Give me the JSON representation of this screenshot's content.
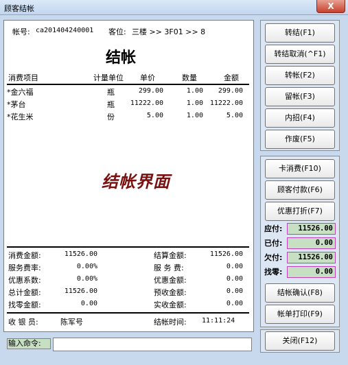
{
  "window": {
    "title": "顾客结帐",
    "close_glyph": "X"
  },
  "header": {
    "account_label": "帐号:",
    "account_no": "ca201404240001",
    "seat_label": "客位:",
    "seat_value": "三楼 >> 3F01 >> 8"
  },
  "receipt_title": "结帐",
  "columns": [
    "消费项目",
    "计量单位",
    "单价",
    "数量",
    "金额"
  ],
  "items": [
    {
      "name": "*金六福",
      "unit": "瓶",
      "price": "299.00",
      "qty": "1.00",
      "amount": "299.00"
    },
    {
      "name": "*茅台",
      "unit": "瓶",
      "price": "11222.00",
      "qty": "1.00",
      "amount": "11222.00"
    },
    {
      "name": "*花生米",
      "unit": "份",
      "price": "5.00",
      "qty": "1.00",
      "amount": "5.00"
    }
  ],
  "watermark": "结帐界面",
  "summary_left": [
    {
      "label": "消费金额:",
      "value": "11526.00"
    },
    {
      "label": "服务费率:",
      "value": "0.00%"
    },
    {
      "label": "优惠系数:",
      "value": "0.00%"
    },
    {
      "label": "总计金额:",
      "value": "11526.00"
    },
    {
      "label": "找零金额:",
      "value": "0.00"
    }
  ],
  "summary_right": [
    {
      "label": "结算金额:",
      "value": "11526.00"
    },
    {
      "label": "服 务 费:",
      "value": "0.00"
    },
    {
      "label": "优惠金额:",
      "value": "0.00"
    },
    {
      "label": "预收金额:",
      "value": "0.00"
    },
    {
      "label": "实收金额:",
      "value": "0.00"
    }
  ],
  "footer": {
    "cashier_label": "收 银 员:",
    "cashier": "陈军号",
    "time_label": "结帐时间:",
    "time": "11:11:24"
  },
  "buttons_top": [
    "转结(F1)",
    "转结取消(^F1)",
    "转帐(F2)",
    "留帐(F3)",
    "内招(F4)",
    "作废(F5)"
  ],
  "buttons_mid": [
    "卡消费(F10)",
    "顾客付款(F6)",
    "优惠打折(F7)"
  ],
  "payment": [
    {
      "label": "应付:",
      "value": "11526.00"
    },
    {
      "label": "已付:",
      "value": "0.00"
    },
    {
      "label": "欠付:",
      "value": "11526.00"
    },
    {
      "label": "找零:",
      "value": "0.00"
    }
  ],
  "buttons_bottom": [
    "结帐确认(F8)",
    "帐单打印(F9)"
  ],
  "close_button": "关闭(F12)",
  "command": {
    "label": "输入命令:",
    "value": ""
  }
}
